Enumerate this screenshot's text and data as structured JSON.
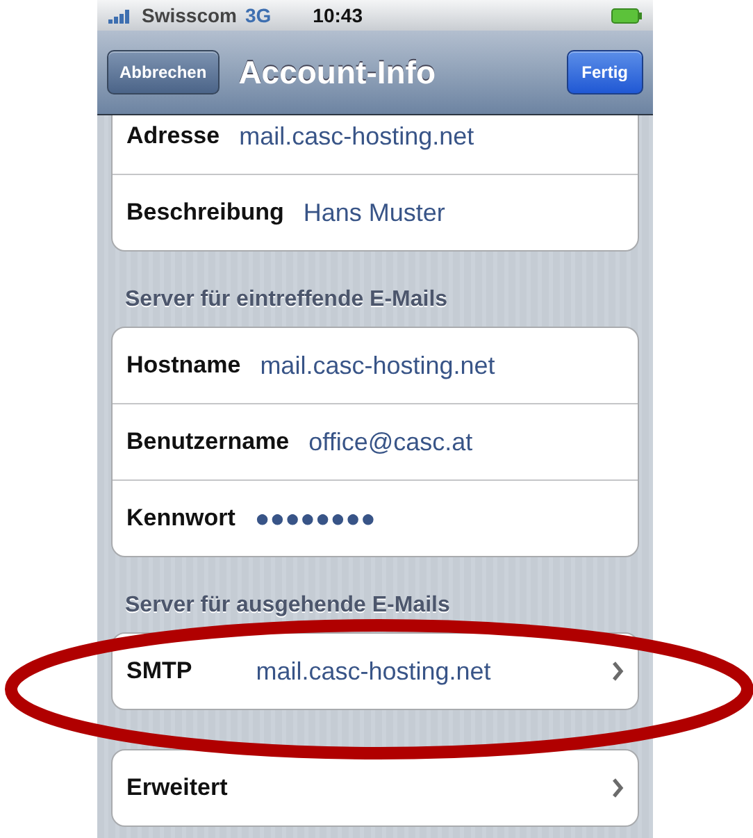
{
  "status_bar": {
    "carrier": "Swisscom",
    "network": "3G",
    "time": "10:43"
  },
  "nav_bar": {
    "title": "Account-Info",
    "left_button": "Abbrechen",
    "right_button": "Fertig"
  },
  "sections": [
    {
      "rows": [
        {
          "kind": "value",
          "label": "Adresse",
          "value": "mail.casc-hosting.net"
        },
        {
          "kind": "value",
          "label": "Beschreibung",
          "value": "Hans Muster"
        }
      ]
    },
    {
      "header": "Server für eintreffende E-Mails",
      "rows": [
        {
          "kind": "value",
          "label": "Hostname",
          "value": "mail.casc-hosting.net"
        },
        {
          "kind": "value",
          "label": "Benutzername",
          "value": "office@casc.at"
        },
        {
          "kind": "value",
          "label": "Kennwort",
          "value": "●●●●●●●●"
        }
      ]
    },
    {
      "header": "Server für ausgehende E-Mails",
      "rows": [
        {
          "kind": "disclosure",
          "label": "SMTP",
          "value": "mail.casc-hosting.net"
        }
      ]
    },
    {
      "rows": [
        {
          "kind": "disclosure",
          "label": "Erweitert"
        }
      ]
    }
  ],
  "annotation": {
    "kind": "ellipse",
    "color": "#b00000"
  }
}
